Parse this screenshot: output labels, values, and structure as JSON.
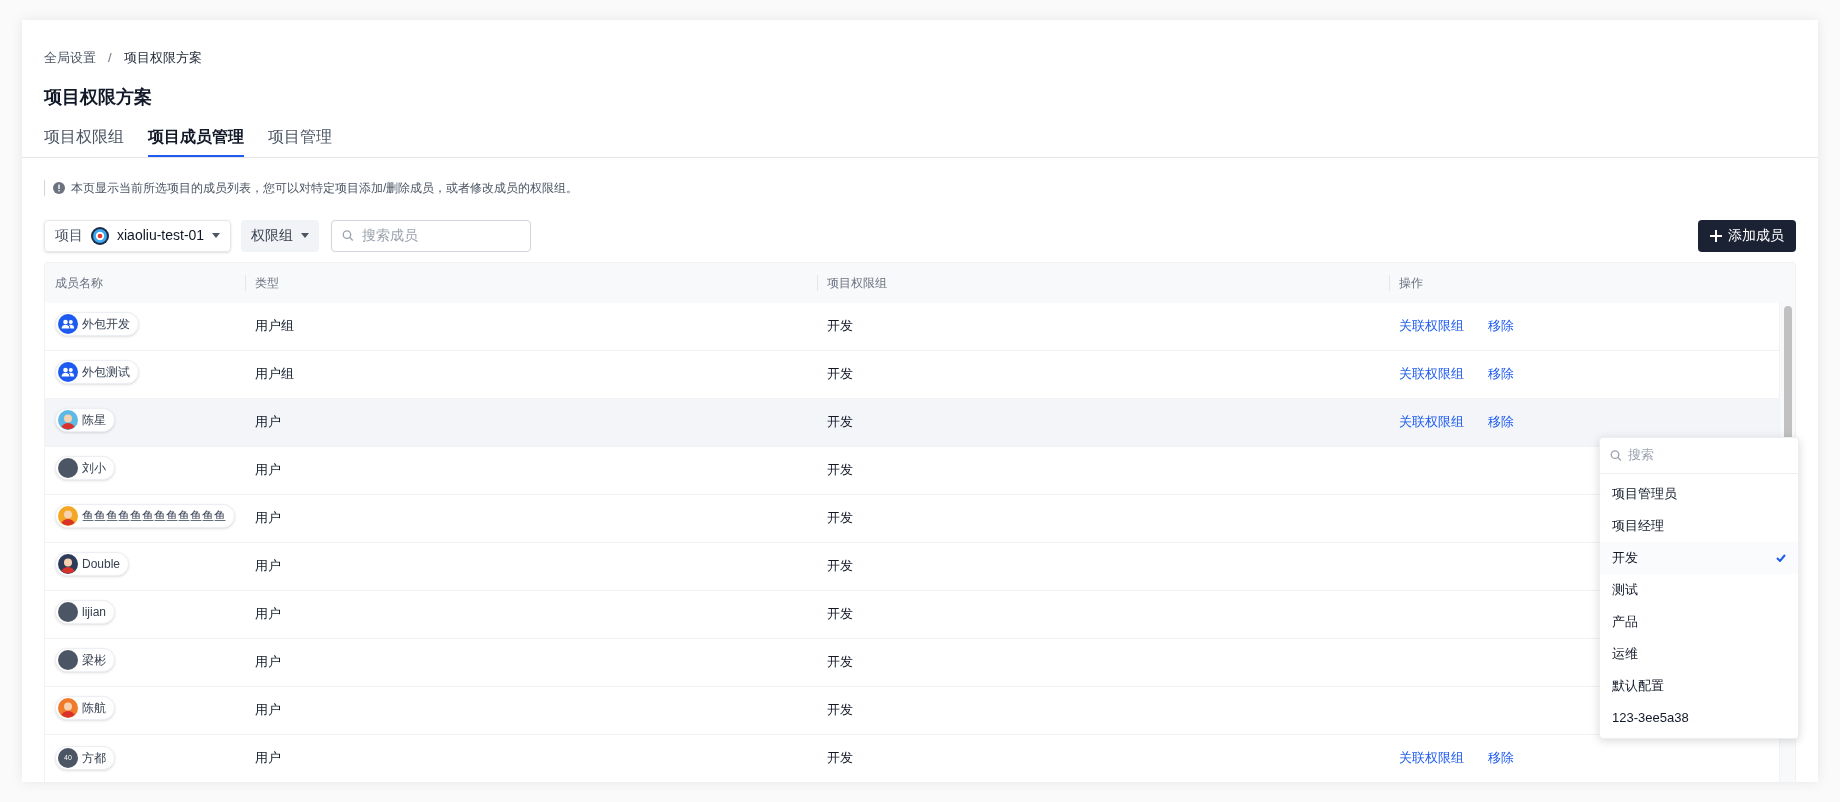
{
  "breadcrumb": [
    "全局设置",
    "项目权限方案"
  ],
  "breadcrumb_separator": "/",
  "title": "项目权限方案",
  "tabs": [
    {
      "label": "项目权限组",
      "selected": false
    },
    {
      "label": "项目成员管理",
      "selected": true
    },
    {
      "label": "项目管理",
      "selected": false
    }
  ],
  "notice": "本页显示当前所选项目的成员列表，您可以对特定项目添加/删除成员，或者修改成员的权限组。",
  "toolbar": {
    "project_label": "项目",
    "project_value": "xiaoliu-test-01",
    "group_filter": "权限组",
    "search": {
      "placeholder": "搜索成员"
    },
    "add_button": "添加成员"
  },
  "table": {
    "columns": [
      "成员名称",
      "类型",
      "项目权限组",
      "操作"
    ],
    "rows": [
      {
        "name": "外包开发",
        "avatar": {
          "kind": "group"
        },
        "type": "用户组",
        "group": "开发",
        "hovered": false,
        "actions": [
          "关联权限组",
          "移除"
        ]
      },
      {
        "name": "外包测试",
        "avatar": {
          "kind": "group"
        },
        "type": "用户组",
        "group": "开发",
        "hovered": false,
        "actions": [
          "关联权限组",
          "移除"
        ]
      },
      {
        "name": "陈星",
        "avatar": {
          "kind": "picture",
          "color": "#5fb8e6"
        },
        "type": "用户",
        "group": "开发",
        "hovered": true,
        "actions": [
          "关联权限组",
          "移除"
        ]
      },
      {
        "name": "刘小",
        "avatar": {
          "kind": "initial"
        },
        "type": "用户",
        "group": "开发",
        "hovered": false
      },
      {
        "name": "鱼鱼鱼鱼鱼鱼鱼鱼鱼鱼鱼鱼",
        "avatar": {
          "kind": "picture",
          "color": "#f5a623"
        },
        "type": "用户",
        "group": "开发",
        "hovered": false
      },
      {
        "name": "Double",
        "avatar": {
          "kind": "picture",
          "color": "#2d3a5a"
        },
        "type": "用户",
        "group": "开发",
        "hovered": false
      },
      {
        "name": "lijian",
        "avatar": {
          "kind": "initial"
        },
        "type": "用户",
        "group": "开发",
        "hovered": false
      },
      {
        "name": "梁彬",
        "avatar": {
          "kind": "initial"
        },
        "type": "用户",
        "group": "开发",
        "hovered": false
      },
      {
        "name": "陈航",
        "avatar": {
          "kind": "picture",
          "color": "#f07a2a"
        },
        "type": "用户",
        "group": "开发",
        "hovered": false
      },
      {
        "name": "方都",
        "avatar": {
          "kind": "initial",
          "text": "40"
        },
        "type": "用户",
        "group": "开发",
        "hovered": false,
        "actions": [
          "关联权限组",
          "移除"
        ]
      }
    ]
  },
  "dropdown": {
    "search": {
      "placeholder": "搜索"
    },
    "options": [
      {
        "label": "项目管理员",
        "selected": false
      },
      {
        "label": "项目经理",
        "selected": false
      },
      {
        "label": "开发",
        "selected": true
      },
      {
        "label": "测试",
        "selected": false
      },
      {
        "label": "产品",
        "selected": false
      },
      {
        "label": "运维",
        "selected": false
      },
      {
        "label": "默认配置",
        "selected": false
      },
      {
        "label": "123-3ee5a38",
        "selected": false
      }
    ]
  }
}
